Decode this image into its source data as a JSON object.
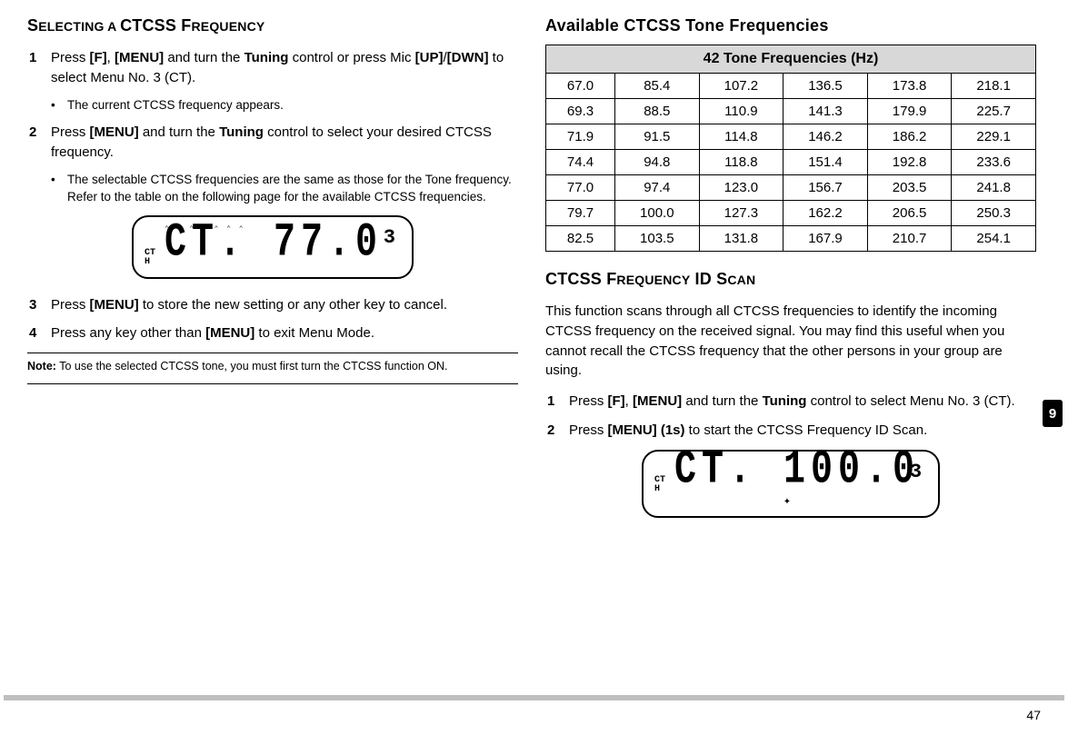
{
  "left": {
    "heading_prefix": "S",
    "heading_small1": "ELECTING A ",
    "heading_bold": "CTCSS F",
    "heading_small2": "REQUENCY",
    "step1_num": "1",
    "step1_body_prefix": "Press ",
    "step1_f": "[F]",
    "step1_comma": ", ",
    "step1_menu": "[MENU]",
    "step1_mid": " and turn the ",
    "step1_tuning": "Tuning",
    "step1_mid2": " control or press Mic ",
    "step1_up": "[UP]",
    "step1_slash": "/",
    "step1_dwn": "[DWN]",
    "step1_end": " to select Menu No. 3 (CT).",
    "bullet1": "The current CTCSS frequency appears.",
    "step2_num": "2",
    "step2_body_prefix": "Press ",
    "step2_menu": "[MENU]",
    "step2_mid": " and turn the ",
    "step2_tuning": "Tuning",
    "step2_end": " control to select your desired CTCSS frequency.",
    "bullet2": "The selectable CTCSS frequencies are the same as those for the Tone frequency.  Refer to the table on the following page for the available CTCSS frequencies.",
    "lcd1_ct1": "CT",
    "lcd1_ct2": "H",
    "lcd1_main": "CT. 77.0",
    "lcd1_sub": "3",
    "step3_num": "3",
    "step3_body_prefix": "Press ",
    "step3_menu": "[MENU]",
    "step3_end": " to store the new setting or any other key to cancel.",
    "step4_num": "4",
    "step4_body_prefix": "Press any key other than ",
    "step4_menu": "[MENU]",
    "step4_end": " to exit Menu Mode.",
    "note_label": "Note:",
    "note_body": "  To use the selected CTCSS tone, you must first turn the CTCSS function ON."
  },
  "right": {
    "avail_heading": "Available CTCSS Tone Frequencies",
    "table_header": "42 Tone Frequencies (Hz)",
    "idscan_prefix": "CTCSS F",
    "idscan_small1": "REQUENCY",
    "idscan_bold2": " ID S",
    "idscan_small2": "CAN",
    "para": "This function scans through all CTCSS frequencies to identify the incoming CTCSS frequency on the received signal.  You may find this useful when you cannot recall the CTCSS frequency that the other persons in your group are using.",
    "step1_num": "1",
    "step1_prefix": "Press ",
    "step1_f": "[F]",
    "step1_comma": ", ",
    "step1_menu": "[MENU]",
    "step1_mid": " and turn the ",
    "step1_tuning": "Tuning",
    "step1_end": " control to select Menu No. 3 (CT).",
    "step2_num": "2",
    "step2_prefix": "Press ",
    "step2_menu": "[MENU] (1s)",
    "step2_end": " to start the CTCSS Frequency ID Scan.",
    "lcd2_ct1": "CT",
    "lcd2_ct2": "H",
    "lcd2_main": "CT. 100.0",
    "lcd2_sub": "3"
  },
  "badge": "9",
  "page_number": "47",
  "chart_data": {
    "type": "table",
    "title": "42 Tone Frequencies (Hz)",
    "rows": [
      [
        67.0,
        85.4,
        107.2,
        136.5,
        173.8,
        218.1
      ],
      [
        69.3,
        88.5,
        110.9,
        141.3,
        179.9,
        225.7
      ],
      [
        71.9,
        91.5,
        114.8,
        146.2,
        186.2,
        229.1
      ],
      [
        74.4,
        94.8,
        118.8,
        151.4,
        192.8,
        233.6
      ],
      [
        77.0,
        97.4,
        123.0,
        156.7,
        203.5,
        241.8
      ],
      [
        79.7,
        100.0,
        127.3,
        162.2,
        206.5,
        250.3
      ],
      [
        82.5,
        103.5,
        131.8,
        167.9,
        210.7,
        254.1
      ]
    ]
  }
}
